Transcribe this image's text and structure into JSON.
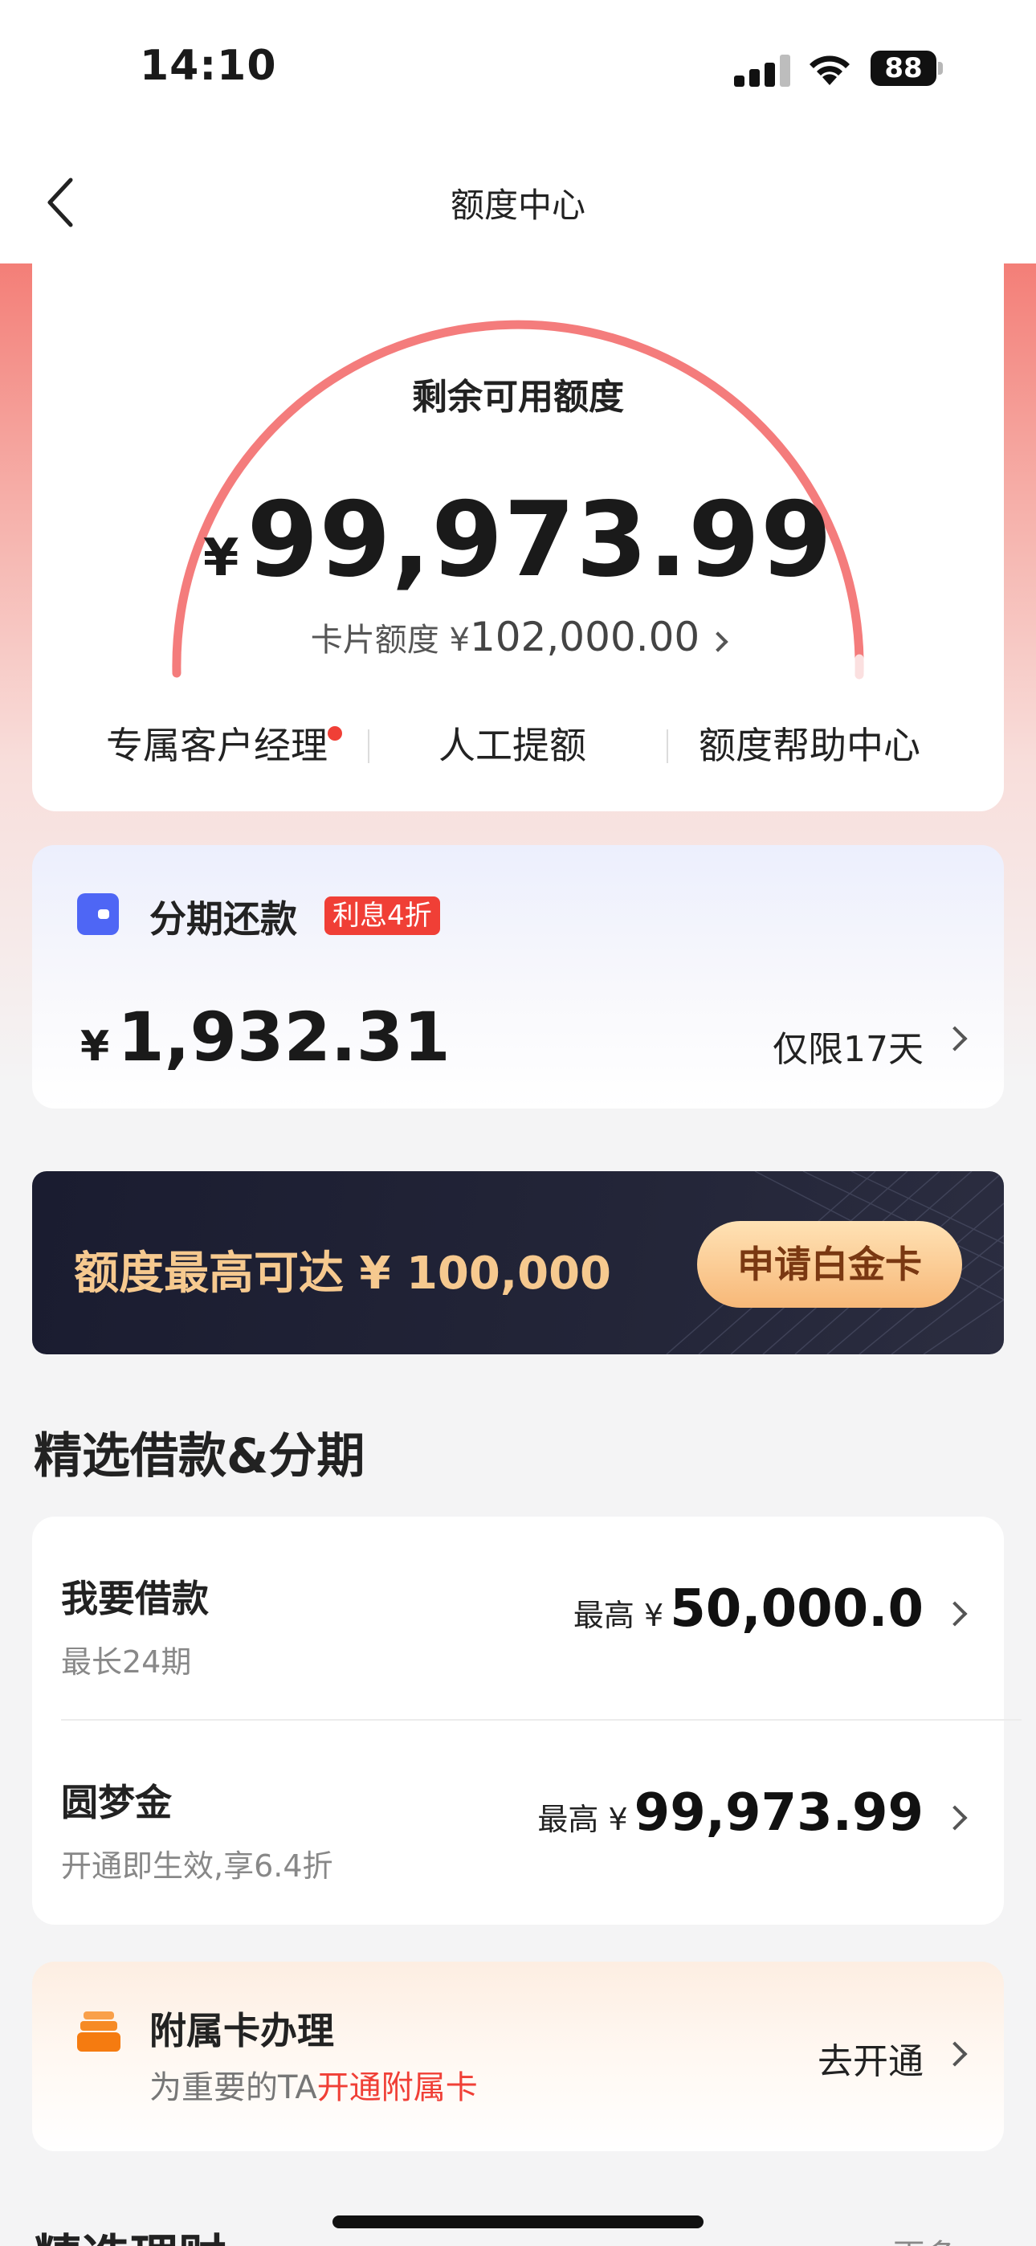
{
  "status_bar": {
    "time": "14:10",
    "battery": "88"
  },
  "nav": {
    "title": "额度中心"
  },
  "quota": {
    "label": "剩余可用额度",
    "currency": "¥",
    "remaining": "99,973.99",
    "card_limit_label": "卡片额度 ¥",
    "card_limit_value": "102,000.00",
    "links": [
      "专属客户经理",
      "人工提额",
      "额度帮助中心"
    ]
  },
  "installment": {
    "title": "分期还款",
    "badge": "利息4折",
    "currency": "¥",
    "amount": "1,932.31",
    "limit_text": "仅限17天"
  },
  "promo": {
    "text": "额度最高可达 ¥ 100,000",
    "button": "申请白金卡"
  },
  "section_title": "精选借款&分期",
  "loans": [
    {
      "name": "我要借款",
      "desc": "最长24期",
      "prefix": "最高 ¥",
      "value": "50,000.0"
    },
    {
      "name": "圆梦金",
      "desc": "开通即生效,享6.4折",
      "prefix": "最高 ¥",
      "value": "99,973.99"
    }
  ],
  "supplementary": {
    "title": "附属卡办理",
    "sub_prefix": "为重要的TA",
    "sub_highlight": "开通附属卡",
    "cta": "去开通"
  },
  "next_section": {
    "title": "精选理财",
    "more": "更多 >"
  },
  "colors": {
    "accent_red": "#f03f36",
    "gauge_arc": "#f47c7c",
    "promo_gold": "#f6c98f",
    "installment_icon": "#4e66f5",
    "supp_icon": "#f57b10"
  }
}
